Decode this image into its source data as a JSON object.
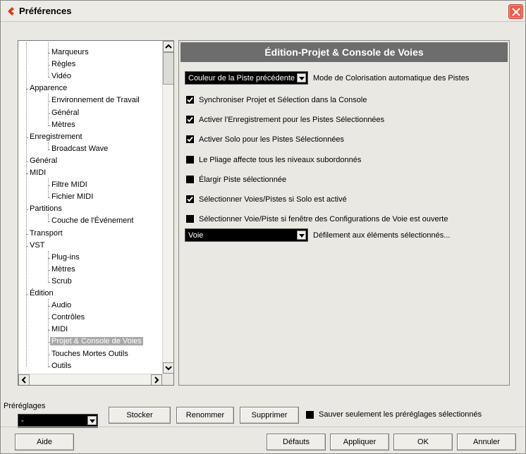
{
  "window": {
    "title": "Préférences",
    "accent": "#e8604b"
  },
  "tree": {
    "items": [
      {
        "label": "Marqueurs",
        "level": 2
      },
      {
        "label": "Règles",
        "level": 2
      },
      {
        "label": "Vidéo",
        "level": 2
      },
      {
        "label": "Apparence",
        "level": 1
      },
      {
        "label": "Environnement de Travail",
        "level": 2
      },
      {
        "label": "Général",
        "level": 2
      },
      {
        "label": "Mètres",
        "level": 2
      },
      {
        "label": "Enregistrement",
        "level": 1
      },
      {
        "label": "Broadcast Wave",
        "level": 2
      },
      {
        "label": "Général",
        "level": 1
      },
      {
        "label": "MIDI",
        "level": 1
      },
      {
        "label": "Filtre MIDI",
        "level": 2
      },
      {
        "label": "Fichier MIDI",
        "level": 2
      },
      {
        "label": "Partitions",
        "level": 1
      },
      {
        "label": "Couche de l'Événement",
        "level": 2
      },
      {
        "label": "Transport",
        "level": 1
      },
      {
        "label": "VST",
        "level": 1
      },
      {
        "label": "Plug-ins",
        "level": 2
      },
      {
        "label": "Mètres",
        "level": 2
      },
      {
        "label": "Scrub",
        "level": 2
      },
      {
        "label": "Édition",
        "level": 1
      },
      {
        "label": "Audio",
        "level": 2
      },
      {
        "label": "Contrôles",
        "level": 2
      },
      {
        "label": "MIDI",
        "level": 2
      },
      {
        "label": "Projet & Console de Voies",
        "level": 2,
        "selected": true
      },
      {
        "label": "Touches Mortes Outils",
        "level": 2
      },
      {
        "label": "Outils",
        "level": 2
      }
    ]
  },
  "panel": {
    "header": "Édition-Projet & Console de Voies",
    "color_mode": {
      "value": "Couleur de la Piste précédente",
      "label": "Mode de Colorisation automatique des Pistes"
    },
    "options": [
      {
        "label": "Synchroniser Projet et Sélection dans la Console",
        "checked": true
      },
      {
        "label": "Activer l'Enregistrement pour les Pistes Sélectionnées",
        "checked": true
      },
      {
        "label": "Activer Solo pour les Pistes Sélectionnées",
        "checked": true
      },
      {
        "label": "Le Pliage affecte tous les niveaux subordonnés",
        "checked": false
      },
      {
        "label": "Élargir Piste sélectionnée",
        "checked": false
      },
      {
        "label": "Sélectionner Voies/Pistes si Solo est activé",
        "checked": true
      },
      {
        "label": "Sélectionner Voie/Piste si fenêtre des Configurations de Voie est ouverte",
        "checked": false
      }
    ],
    "scroll_mode": {
      "value": "Voie",
      "label": "Défilement aux éléments sélectionnés..."
    }
  },
  "presets": {
    "label": "Préréglages",
    "value": "-",
    "store": "Stocker",
    "rename": "Renommer",
    "delete": "Supprimer",
    "save_selected_label": "Sauver seulement les préréglages sélectionnés",
    "save_selected_checked": false
  },
  "footer": {
    "help": "Aide",
    "defaults": "Défauts",
    "apply": "Appliquer",
    "ok": "OK",
    "cancel": "Annuler"
  }
}
